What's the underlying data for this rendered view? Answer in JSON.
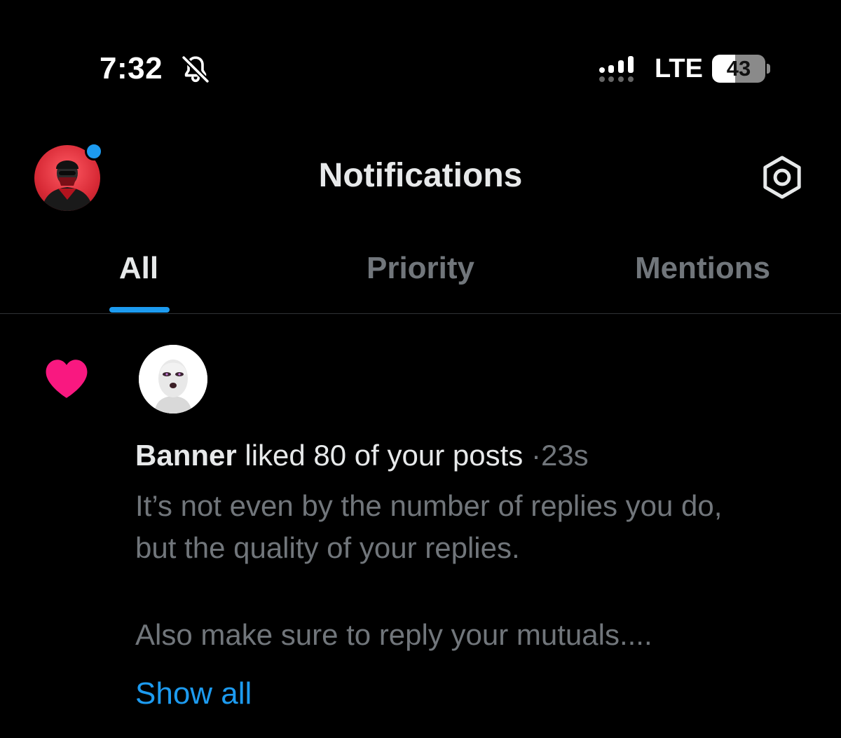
{
  "status_bar": {
    "time": "7:32",
    "network": "LTE",
    "battery": "43",
    "battery_fraction": 0.43,
    "icons": [
      "bell-slash-icon",
      "cellular-signal-icon"
    ]
  },
  "header": {
    "title": "Notifications",
    "icons": [
      "profile-avatar",
      "gear-icon"
    ],
    "accent_color": "#1d9bf0"
  },
  "tabs": [
    {
      "label": "All",
      "selected": true
    },
    {
      "label": "Priority",
      "selected": false
    },
    {
      "label": "Mentions",
      "selected": false
    }
  ],
  "notification": {
    "icon": "heart-icon",
    "icon_color": "#f91880",
    "user": "Banner",
    "action": "liked 80 of your posts",
    "separator": "·",
    "time": "23s",
    "text_line_1": "It’s not even by the number of replies you do,",
    "text_line_2": "but the quality of your replies.",
    "text_line_3": "Also make sure to reply your mutuals....",
    "show_all": "Show all"
  }
}
